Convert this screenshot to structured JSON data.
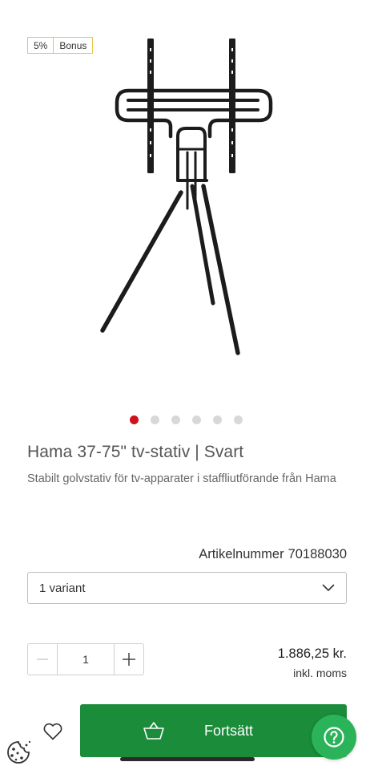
{
  "badge": {
    "percent": "5%",
    "label": "Bonus"
  },
  "image": {
    "name": "tv-stand-image",
    "dots_total": 6,
    "active_dot": 0
  },
  "product": {
    "title": "Hama 37-75\" tv-stativ | Svart",
    "subtitle": "Stabilt golvstativ för tv-apparater i staffliutförande från Hama",
    "article_label": "Artikelnummer",
    "article_number": "70188030"
  },
  "variant": {
    "selected": "1 variant",
    "icon": "chevron-down-icon"
  },
  "quantity": {
    "value": "1",
    "minus_icon": "minus-icon",
    "plus_icon": "plus-icon"
  },
  "price": {
    "amount": "1.886,25 kr.",
    "vat_note": "inkl. moms"
  },
  "actions": {
    "wishlist_icon": "heart-icon",
    "cookie_icon": "cookie-icon",
    "basket_icon": "basket-icon",
    "continue_label": "Fortsätt",
    "help_icon": "help-icon"
  },
  "colors": {
    "brand_green": "#1a8c3a",
    "help_green": "#2bb35a",
    "dot_active": "#d0101d",
    "badge_border": "#e8c64a"
  }
}
